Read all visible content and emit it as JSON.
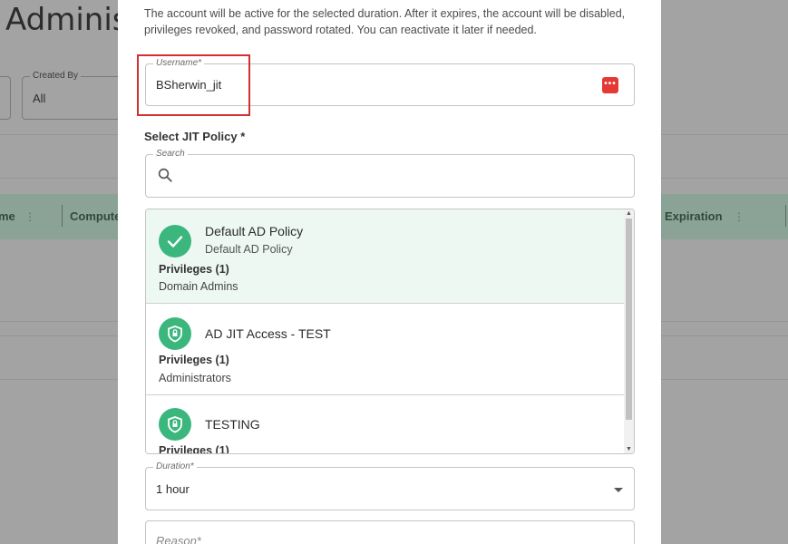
{
  "background": {
    "page_title": "Adminis",
    "filter": {
      "label": "Created By",
      "value": "All"
    },
    "columns": [
      "me",
      "Compute",
      "Expiration"
    ]
  },
  "modal": {
    "description": "The account will be active for the selected duration. After it expires, the account will be disabled, privileges revoked, and password rotated. You can reactivate it later if needed.",
    "username": {
      "label": "Username*",
      "value": "BSherwin_jit",
      "icon": "password-generator-icon",
      "icon_glyph": "•••"
    },
    "policy_section_label": "Select JIT Policy *",
    "search": {
      "label": "Search",
      "placeholder": ""
    },
    "policies": [
      {
        "name": "Default AD Policy",
        "subtitle": "Default AD Policy",
        "privileges_label": "Privileges (1)",
        "privilege": "Domain Admins",
        "selected": true,
        "icon": "check-icon"
      },
      {
        "name": "AD JIT Access - TEST",
        "subtitle": "",
        "privileges_label": "Privileges (1)",
        "privilege": "Administrators",
        "selected": false,
        "icon": "shield-lock-icon"
      },
      {
        "name": "TESTING",
        "subtitle": "",
        "privileges_label": "Privileges (1)",
        "privilege": "",
        "selected": false,
        "icon": "shield-lock-icon"
      }
    ],
    "duration": {
      "label": "Duration*",
      "value": "1 hour"
    },
    "reason": {
      "label": "Reason*"
    }
  },
  "colors": {
    "accent": "#3bb77e",
    "highlight": "#d32f2f",
    "selected_bg": "#edf8f2",
    "pw_icon": "#e53935"
  }
}
